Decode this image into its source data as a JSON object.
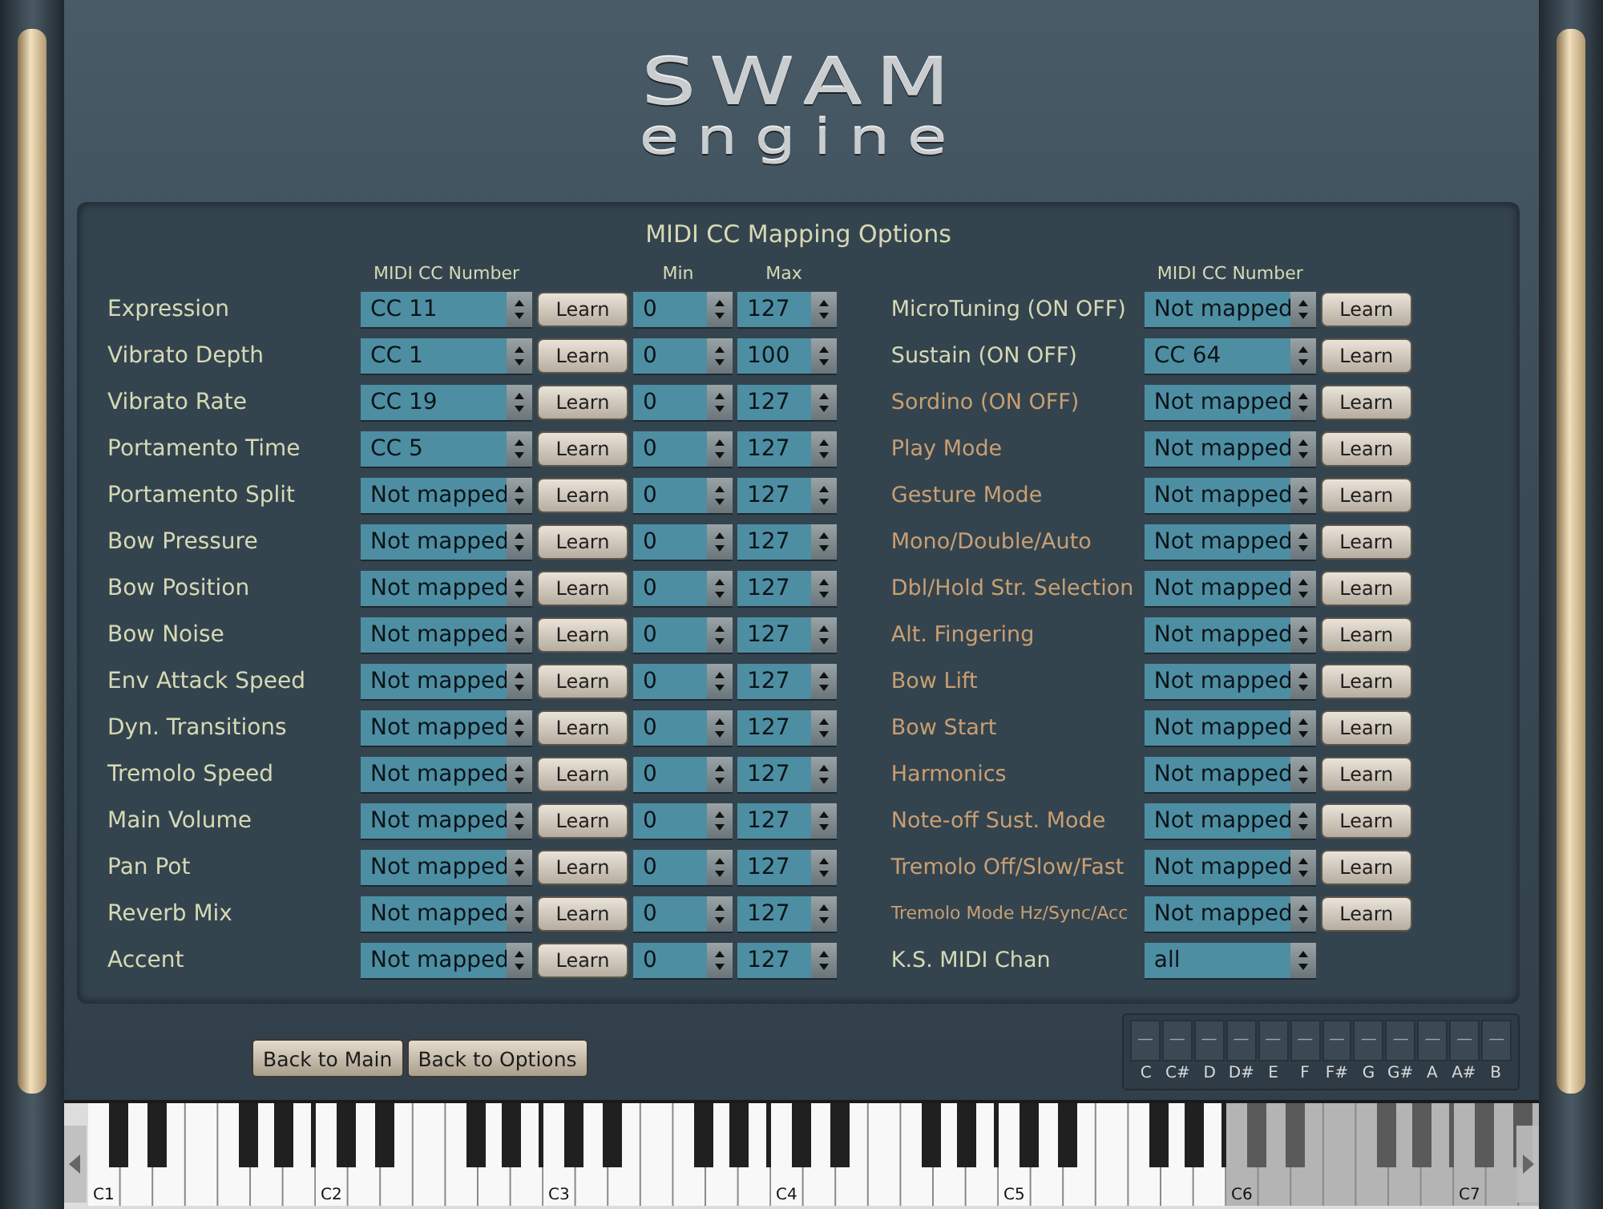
{
  "logo": {
    "line_1": "SWAM",
    "line_2": "engine"
  },
  "panel": {
    "title": "MIDI CC Mapping Options",
    "left_headers": {
      "cc": "MIDI CC Number",
      "min": "Min",
      "max": "Max"
    },
    "right_headers": {
      "cc": "MIDI CC Number"
    },
    "left_rows": [
      {
        "label": "Expression",
        "cc": "CC 11",
        "learn": "Learn",
        "min": "0",
        "max": "127"
      },
      {
        "label": "Vibrato Depth",
        "cc": "CC 1",
        "learn": "Learn",
        "min": "0",
        "max": "100"
      },
      {
        "label": "Vibrato Rate",
        "cc": "CC 19",
        "learn": "Learn",
        "min": "0",
        "max": "127"
      },
      {
        "label": "Portamento Time",
        "cc": "CC 5",
        "learn": "Learn",
        "min": "0",
        "max": "127"
      },
      {
        "label": "Portamento Split",
        "cc": "Not mapped",
        "learn": "Learn",
        "min": "0",
        "max": "127"
      },
      {
        "label": "Bow Pressure",
        "cc": "Not mapped",
        "learn": "Learn",
        "min": "0",
        "max": "127"
      },
      {
        "label": "Bow Position",
        "cc": "Not mapped",
        "learn": "Learn",
        "min": "0",
        "max": "127"
      },
      {
        "label": "Bow Noise",
        "cc": "Not mapped",
        "learn": "Learn",
        "min": "0",
        "max": "127"
      },
      {
        "label": "Env Attack Speed",
        "cc": "Not mapped",
        "learn": "Learn",
        "min": "0",
        "max": "127"
      },
      {
        "label": "Dyn. Transitions",
        "cc": "Not mapped",
        "learn": "Learn",
        "min": "0",
        "max": "127"
      },
      {
        "label": "Tremolo Speed",
        "cc": "Not mapped",
        "learn": "Learn",
        "min": "0",
        "max": "127"
      },
      {
        "label": "Main Volume",
        "cc": "Not mapped",
        "learn": "Learn",
        "min": "0",
        "max": "127"
      },
      {
        "label": "Pan Pot",
        "cc": "Not mapped",
        "learn": "Learn",
        "min": "0",
        "max": "127"
      },
      {
        "label": "Reverb Mix",
        "cc": "Not mapped",
        "learn": "Learn",
        "min": "0",
        "max": "127"
      },
      {
        "label": "Accent",
        "cc": "Not mapped",
        "learn": "Learn",
        "min": "0",
        "max": "127"
      }
    ],
    "right_rows": [
      {
        "kind": "mapping",
        "label": "MicroTuning (ON OFF)",
        "color": "#d6d9b4",
        "cc": "Not mapped",
        "learn": "Learn"
      },
      {
        "kind": "mapping",
        "label": "Sustain (ON OFF)",
        "color": "#d6d9b4",
        "cc": "CC 64",
        "learn": "Learn"
      },
      {
        "kind": "mapping",
        "label": "Sordino (ON OFF)",
        "color": "#c99f72",
        "cc": "Not mapped",
        "learn": "Learn"
      },
      {
        "kind": "mapping",
        "label": "Play Mode",
        "color": "#c99f72",
        "cc": "Not mapped",
        "learn": "Learn"
      },
      {
        "kind": "mapping",
        "label": "Gesture Mode",
        "color": "#c99f72",
        "cc": "Not mapped",
        "learn": "Learn"
      },
      {
        "kind": "mapping",
        "label": "Mono/Double/Auto",
        "color": "#c99f72",
        "cc": "Not mapped",
        "learn": "Learn"
      },
      {
        "kind": "mapping",
        "label": "Dbl/Hold Str. Selection",
        "color": "#c99f72",
        "cc": "Not mapped",
        "learn": "Learn"
      },
      {
        "kind": "mapping",
        "label": "Alt. Fingering",
        "color": "#c99f72",
        "cc": "Not mapped",
        "learn": "Learn"
      },
      {
        "kind": "mapping",
        "label": "Bow Lift",
        "color": "#c99f72",
        "cc": "Not mapped",
        "learn": "Learn"
      },
      {
        "kind": "mapping",
        "label": "Bow Start",
        "color": "#c99f72",
        "cc": "Not mapped",
        "learn": "Learn"
      },
      {
        "kind": "mapping",
        "label": "Harmonics",
        "color": "#c99f72",
        "cc": "Not mapped",
        "learn": "Learn"
      },
      {
        "kind": "mapping",
        "label": "Note-off Sust. Mode",
        "color": "#c99f72",
        "cc": "Not mapped",
        "learn": "Learn"
      },
      {
        "kind": "mapping",
        "label": "Tremolo Off/Slow/Fast",
        "color": "#c99f72",
        "cc": "Not mapped",
        "learn": "Learn"
      },
      {
        "kind": "small",
        "label": "Tremolo Mode Hz/Sync/Acc",
        "color": "#c99f72",
        "cc": "Not mapped",
        "learn": "Learn"
      },
      {
        "kind": "channel",
        "label": "K.S. MIDI Chan",
        "color": "#d6d9b4",
        "cc": "all"
      }
    ]
  },
  "buttons": [
    "Back to Main",
    "Back to Options"
  ],
  "key_switch": {
    "cells": [
      "—",
      "—",
      "—",
      "—",
      "—",
      "—",
      "—",
      "—",
      "—",
      "—",
      "—",
      "—"
    ],
    "notes": [
      "C",
      "C#",
      "D",
      "D#",
      "E",
      "F",
      "F#",
      "G",
      "G#",
      "A",
      "A#",
      "B"
    ]
  },
  "keyboard": {
    "octaves": [
      {
        "label": "C1",
        "active": true
      },
      {
        "label": "C2",
        "active": true
      },
      {
        "label": "C3",
        "active": true
      },
      {
        "label": "C4",
        "active": true
      },
      {
        "label": "C5",
        "active": true
      },
      {
        "label": "C6",
        "active": false
      },
      {
        "label": "C7",
        "active": false
      }
    ]
  }
}
